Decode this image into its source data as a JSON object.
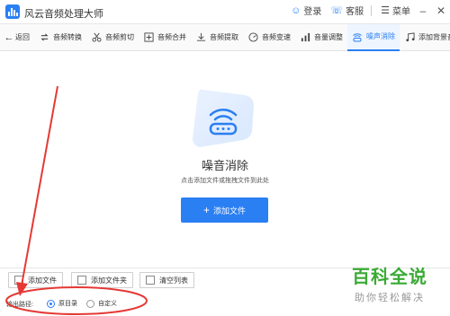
{
  "app": {
    "title": "风云音频处理大师"
  },
  "titlebar": {
    "login": "登录",
    "service": "客服",
    "menu": "菜单"
  },
  "toolbar": {
    "back": "返回",
    "items": [
      {
        "label": "音频转换",
        "icon": "music-convert-icon"
      },
      {
        "label": "音频剪切",
        "icon": "scissors-icon"
      },
      {
        "label": "音频合并",
        "icon": "merge-icon"
      },
      {
        "label": "音频提取",
        "icon": "extract-icon"
      },
      {
        "label": "音频变速",
        "icon": "speed-icon"
      },
      {
        "label": "音量调整",
        "icon": "volume-icon"
      },
      {
        "label": "噪声消除",
        "icon": "noise-icon",
        "active": true
      },
      {
        "label": "添加背景音乐",
        "icon": "music-note-icon"
      }
    ]
  },
  "main": {
    "title": "噪音消除",
    "hint": "点击添加文件或拖拽文件到此处",
    "add_button": "添加文件"
  },
  "bottom": {
    "add_file": "添加文件",
    "add_folder": "添加文件夹",
    "clear_list": "清空列表",
    "output_label": "输出路径:",
    "radio_original": "原目录",
    "radio_custom": "自定义"
  },
  "watermark": {
    "main": "百科全说",
    "sub": "助你轻松解决"
  },
  "colors": {
    "accent": "#2a7ff3",
    "annotation": "#e53935",
    "watermark": "#3aaa35"
  }
}
